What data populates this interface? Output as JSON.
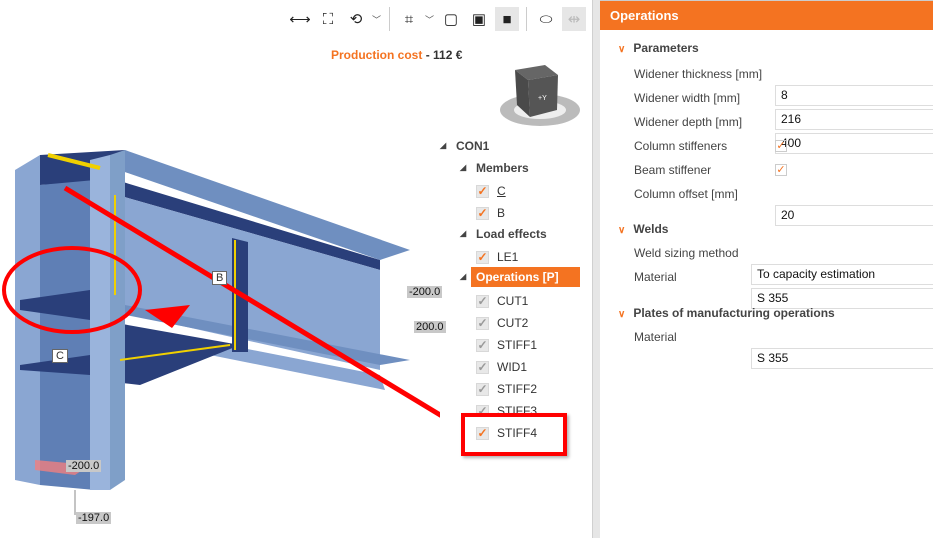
{
  "toolbar": {
    "items": [
      {
        "name": "measure-icon",
        "glyph": "⟷"
      },
      {
        "name": "fit-view-icon",
        "glyph": "⛶"
      },
      {
        "name": "rotate-icon",
        "glyph": "⟲"
      },
      {
        "name": "crop-icon",
        "glyph": "⌗"
      },
      {
        "name": "wireframe-icon",
        "glyph": "▢"
      },
      {
        "name": "transparent-icon",
        "glyph": "▣"
      },
      {
        "name": "solid-icon",
        "glyph": "■"
      },
      {
        "name": "section-icon",
        "glyph": "⬭"
      },
      {
        "name": "mirror-icon",
        "glyph": "⇹"
      },
      {
        "name": "home-icon",
        "glyph": "⌂"
      }
    ]
  },
  "cost": {
    "label": "Production cost",
    "sep": "-",
    "value": "112 €"
  },
  "model": {
    "member_b": "B",
    "member_c": "C",
    "dims": [
      "-200.0",
      "200.0",
      "-200.0",
      "-197.0"
    ],
    "cube_face": "+Y"
  },
  "tree": {
    "root": "CON1",
    "members_label": "Members",
    "members": [
      "C",
      "B"
    ],
    "load_label": "Load effects",
    "loads": [
      "LE1"
    ],
    "ops_label": "Operations [P]",
    "ops": [
      "CUT1",
      "CUT2",
      "STIFF1",
      "WID1",
      "STIFF2",
      "STIFF3",
      "STIFF4"
    ]
  },
  "panel": {
    "title": "Operations",
    "parameters": {
      "title": "Parameters",
      "widener_thickness_label": "Widener thickness [mm]",
      "widener_thickness": "8",
      "widener_width_label": "Widener width [mm]",
      "widener_width": "216",
      "widener_depth_label": "Widener depth [mm]",
      "widener_depth": "400",
      "column_stiffeners_label": "Column stiffeners",
      "beam_stiffener_label": "Beam stiffener",
      "column_offset_label": "Column offset [mm]",
      "column_offset": "20"
    },
    "welds": {
      "title": "Welds",
      "method_label": "Weld sizing method",
      "method": "To capacity estimation",
      "material_label": "Material",
      "material": "S 355"
    },
    "plates": {
      "title": "Plates of manufacturing operations",
      "material_label": "Material",
      "material": "S 355"
    }
  },
  "colors": {
    "accent": "#f47321",
    "highlight": "#ff0000",
    "steel": "#7f9fc8"
  }
}
